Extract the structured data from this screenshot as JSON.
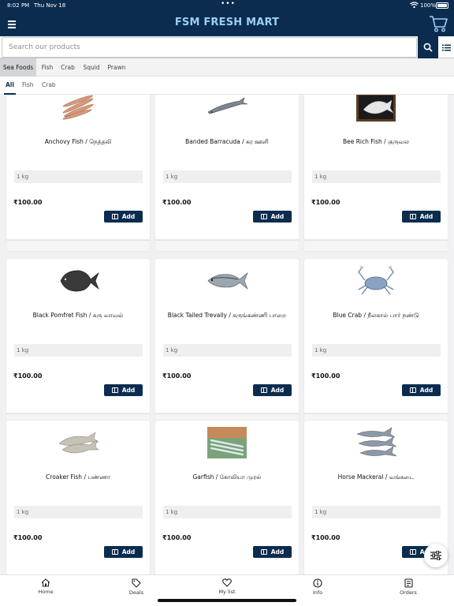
{
  "status_bar": {
    "time": "8:02 PM",
    "date": "Thu Nov 18",
    "battery": "100%"
  },
  "header": {
    "brand": "FSM FRESH MART"
  },
  "search": {
    "placeholder": "Search our products"
  },
  "categories": [
    {
      "label": "Sea Foods",
      "active": true
    },
    {
      "label": "Fish",
      "active": false
    },
    {
      "label": "Crab",
      "active": false
    },
    {
      "label": "Squid",
      "active": false
    },
    {
      "label": "Prawn",
      "active": false
    }
  ],
  "subcategories": [
    {
      "label": "All",
      "active": true
    },
    {
      "label": "Fish",
      "active": false
    },
    {
      "label": "Crab",
      "active": false
    }
  ],
  "products": [
    {
      "name": "Anchovy Fish / நெத்தலி",
      "weight": "1 kg",
      "price": "₹100.00",
      "add_label": "Add",
      "icon": "anchovy-fish-image"
    },
    {
      "name": "Banded Barracuda / கர ஊளி",
      "weight": "1 kg",
      "price": "₹100.00",
      "add_label": "Add",
      "icon": "barracuda-fish-image"
    },
    {
      "name": "Bee Rich Fish / குருவல",
      "weight": "1 kg",
      "price": "₹100.00",
      "add_label": "Add",
      "icon": "bee-rich-fish-image"
    },
    {
      "name": "Black Pomfret Fish / கரு வாவல்",
      "weight": "1 kg",
      "price": "₹100.00",
      "add_label": "Add",
      "icon": "black-pomfret-fish-image"
    },
    {
      "name": "Black Tailed Trevally / கருங்கண்ணி பாறை",
      "weight": "1 kg",
      "price": "₹100.00",
      "add_label": "Add",
      "icon": "trevally-fish-image"
    },
    {
      "name": "Blue Crab / நீலகால் பார் நண்டு",
      "weight": "1 kg",
      "price": "₹100.00",
      "add_label": "Add",
      "icon": "blue-crab-image"
    },
    {
      "name": "Croaker Fish / பண்ணா",
      "weight": "1 kg",
      "price": "₹100.00",
      "add_label": "Add",
      "icon": "croaker-fish-image"
    },
    {
      "name": "Garfish / கோலியா முரல்",
      "weight": "1 kg",
      "price": "₹100.00",
      "add_label": "Add",
      "icon": "garfish-image"
    },
    {
      "name": "Horse Mackeral / வங்கடை",
      "weight": "1 kg",
      "price": "₹100.00",
      "add_label": "Add",
      "icon": "horse-mackerel-image"
    }
  ],
  "bottom_nav": [
    {
      "label": "Home",
      "icon": "home-icon"
    },
    {
      "label": "Deals",
      "icon": "tag-icon"
    },
    {
      "label": "My list",
      "icon": "heart-icon"
    },
    {
      "label": "Info",
      "icon": "info-icon"
    },
    {
      "label": "Orders",
      "icon": "orders-icon"
    }
  ],
  "colors": {
    "primary": "#0c2c4f",
    "brand_text": "#9ad0f5",
    "background": "#f1f1f3"
  }
}
